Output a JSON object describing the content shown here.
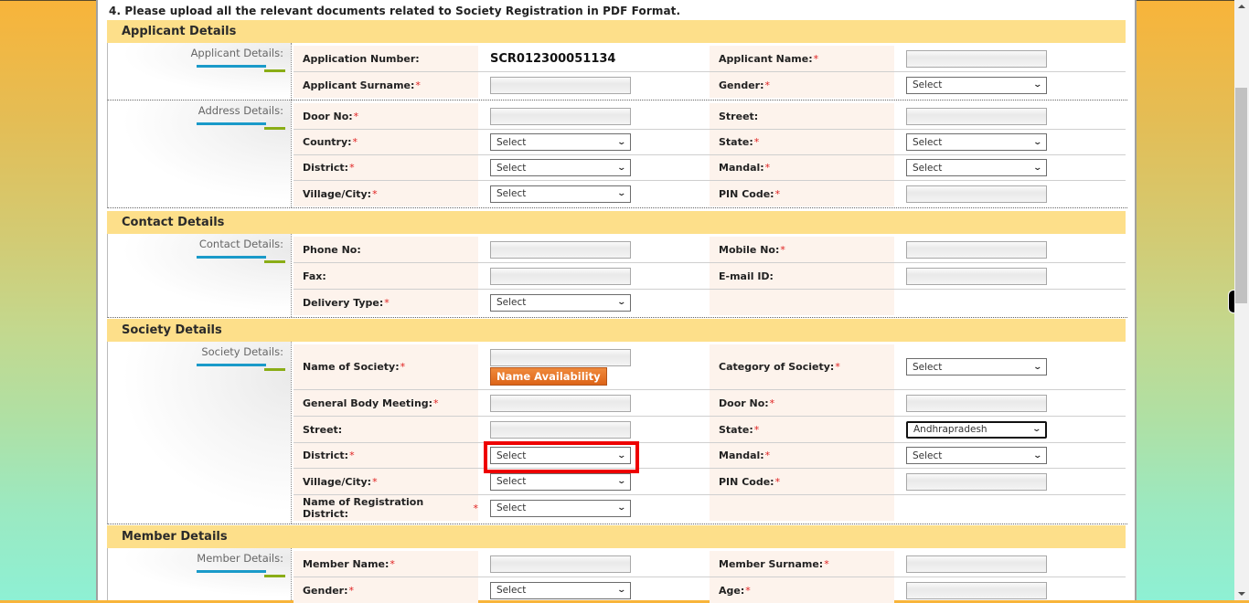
{
  "notice": "4. Please upload all the relevant documents related to Society Registration in PDF Format.",
  "colors": {
    "section_header": "#fddf8a",
    "label_bg": "#fdf3ec",
    "accent_blue": "#1a9ac9",
    "accent_green": "#8aad16",
    "required": "#e02020",
    "button": "#e4702a",
    "highlight": "#ee0000"
  },
  "sections": {
    "applicant": {
      "title": "Applicant Details",
      "groups": {
        "applicant": {
          "side_label": "Applicant Details:",
          "application_number_label": "Application Number:",
          "application_number_value": "SCR012300051134",
          "applicant_name_label": "Applicant Name:",
          "applicant_surname_label": "Applicant Surname:",
          "gender_label": "Gender:",
          "gender_value": "Select"
        },
        "address": {
          "side_label": "Address Details:",
          "door_label": "Door No:",
          "street_label": "Street:",
          "country_label": "Country:",
          "country_value": "Select",
          "state_label": "State:",
          "state_value": "Select",
          "district_label": "District:",
          "district_value": "Select",
          "mandal_label": "Mandal:",
          "mandal_value": "Select",
          "village_label": "Village/City:",
          "village_value": "Select",
          "pin_label": "PIN Code:"
        }
      }
    },
    "contact": {
      "title": "Contact Details",
      "side_label": "Contact Details:",
      "phone_label": "Phone No:",
      "mobile_label": "Mobile No:",
      "fax_label": "Fax:",
      "email_label": "E-mail ID:",
      "delivery_label": "Delivery Type:",
      "delivery_value": "Select"
    },
    "society": {
      "title": "Society Details",
      "side_label": "Society Details:",
      "name_label": "Name of  Society:",
      "name_availability_button": "Name Availability",
      "category_label": "Category of Society:",
      "category_value": "Select",
      "gbm_label": "General Body Meeting:",
      "door_label": "Door No:",
      "street_label": "Street:",
      "state_label": "State:",
      "state_value": "Andhrapradesh",
      "district_label": "District:",
      "district_value": "Select",
      "mandal_label": "Mandal:",
      "mandal_value": "Select",
      "village_label": "Village/City:",
      "village_value": "Select",
      "pin_label": "PIN Code:",
      "reg_district_label": "Name of Registration District:",
      "reg_district_value": "Select"
    },
    "member": {
      "title": "Member Details",
      "side_label": "Member Details:",
      "name_label": "Member Name:",
      "surname_label": "Member Surname:",
      "gender_label": "Gender:",
      "gender_value": "Select",
      "age_label": "Age:"
    }
  },
  "required_mark": "*",
  "chevron": "⌄"
}
